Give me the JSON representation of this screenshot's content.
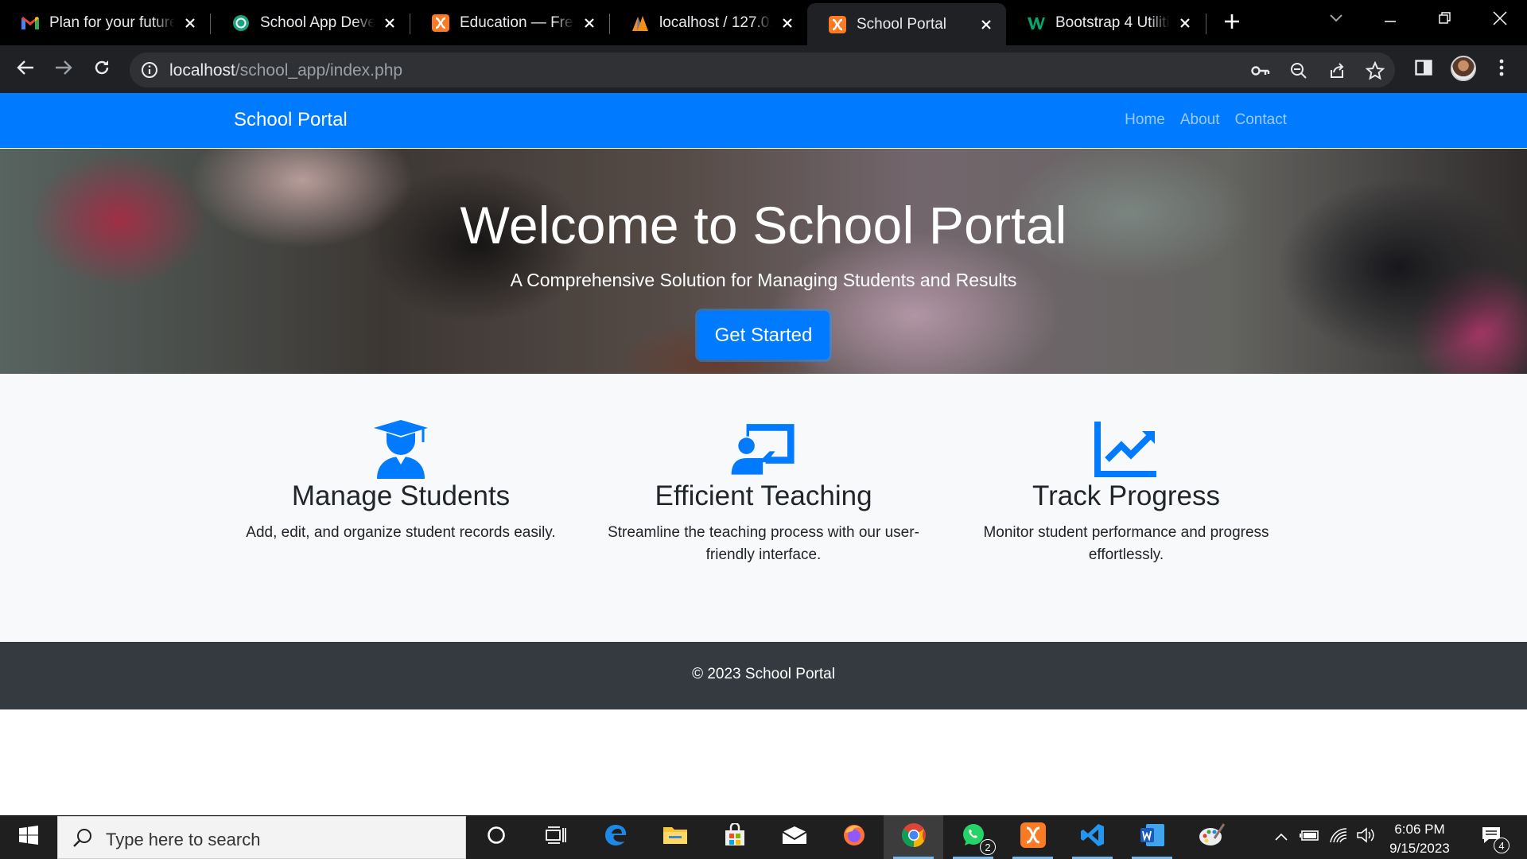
{
  "browser": {
    "tabs": [
      {
        "title": "Plan for your future",
        "favicon": "gmail-icon"
      },
      {
        "title": "School App Development",
        "favicon": "chatgpt-icon"
      },
      {
        "title": "Education — Free Website",
        "favicon": "xampp-icon"
      },
      {
        "title": "localhost / 127.0.0.1",
        "favicon": "phpmyadmin-icon"
      },
      {
        "title": "School Portal",
        "favicon": "xampp-icon",
        "active": true
      },
      {
        "title": "Bootstrap 4 Utilities",
        "favicon": "w3schools-icon"
      }
    ],
    "address": {
      "host": "localhost",
      "path": "/school_app/index.php"
    }
  },
  "navbar": {
    "brand": "School Portal",
    "links": [
      "Home",
      "About",
      "Contact"
    ]
  },
  "hero": {
    "title": "Welcome to School Portal",
    "subtitle": "A Comprehensive Solution for Managing Students and Results",
    "button": "Get Started"
  },
  "features": [
    {
      "icon": "graduate-icon",
      "title": "Manage Students",
      "text": "Add, edit, and organize student records easily."
    },
    {
      "icon": "chalkboard-teacher-icon",
      "title": "Efficient Teaching",
      "text": "Streamline the teaching process with our user-friendly interface."
    },
    {
      "icon": "chart-line-icon",
      "title": "Track Progress",
      "text": "Monitor student performance and progress effortlessly."
    }
  ],
  "footer": {
    "text": "© 2023 School Portal"
  },
  "taskbar": {
    "search_placeholder": "Type here to search",
    "time": "6:06 PM",
    "date": "9/15/2023",
    "whatsapp_badge": "2",
    "notification_badge": "4"
  },
  "colors": {
    "primary": "#007bff",
    "footer_bg": "#343a40",
    "features_bg": "#f8f9fa"
  }
}
